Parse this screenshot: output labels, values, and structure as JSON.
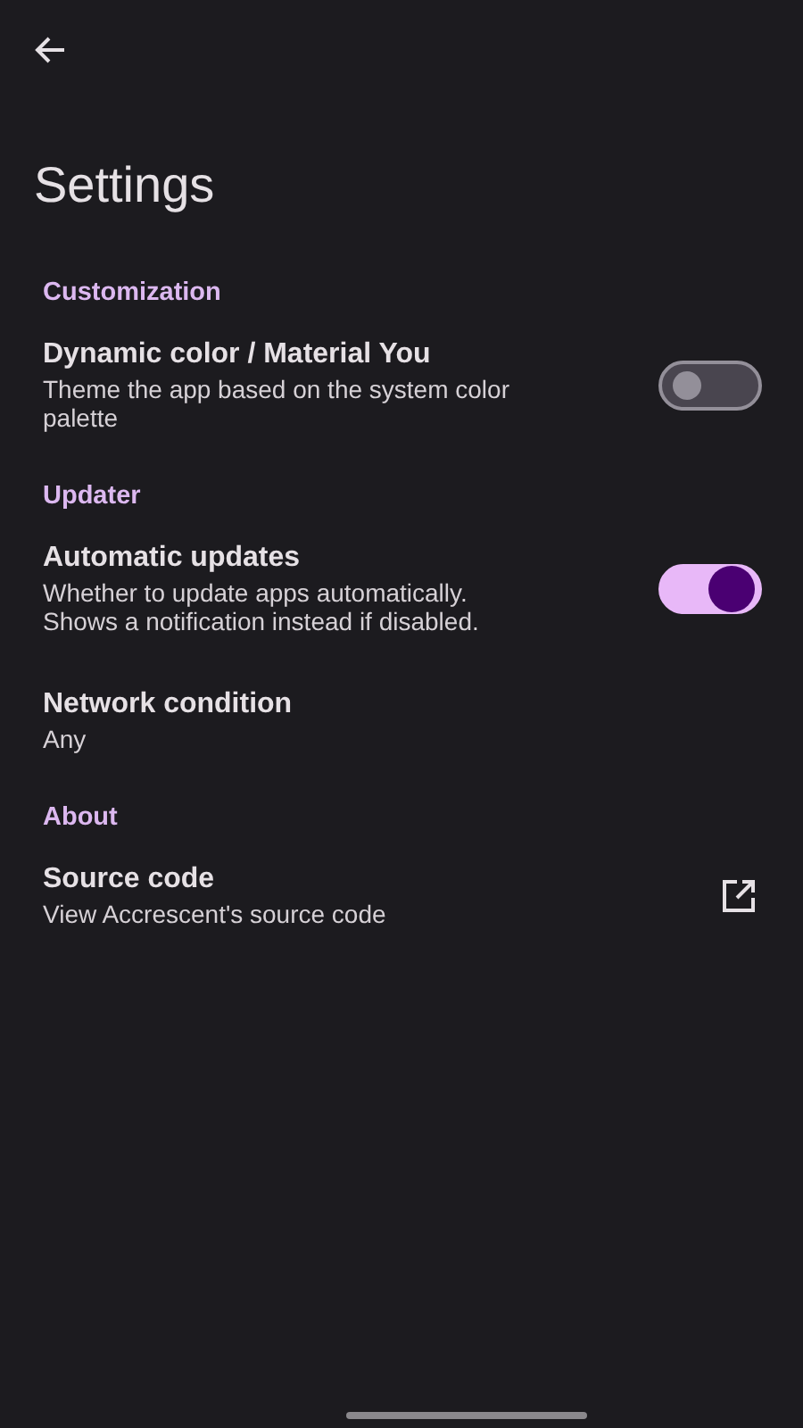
{
  "title": "Settings",
  "sections": [
    {
      "header": "Customization",
      "items": [
        {
          "kind": "switch",
          "title": "Dynamic color / Material You",
          "subtitle": "Theme the app based on the system color palette",
          "on": false
        }
      ]
    },
    {
      "header": "Updater",
      "items": [
        {
          "kind": "switch",
          "title": "Automatic updates",
          "subtitle": "Whether to update apps automatically. Shows a notification instead if disabled.",
          "on": true
        },
        {
          "kind": "plain",
          "title": "Network condition",
          "subtitle": "Any"
        }
      ]
    },
    {
      "header": "About",
      "items": [
        {
          "kind": "link",
          "title": "Source code",
          "subtitle": "View Accrescent's source code"
        }
      ]
    }
  ]
}
